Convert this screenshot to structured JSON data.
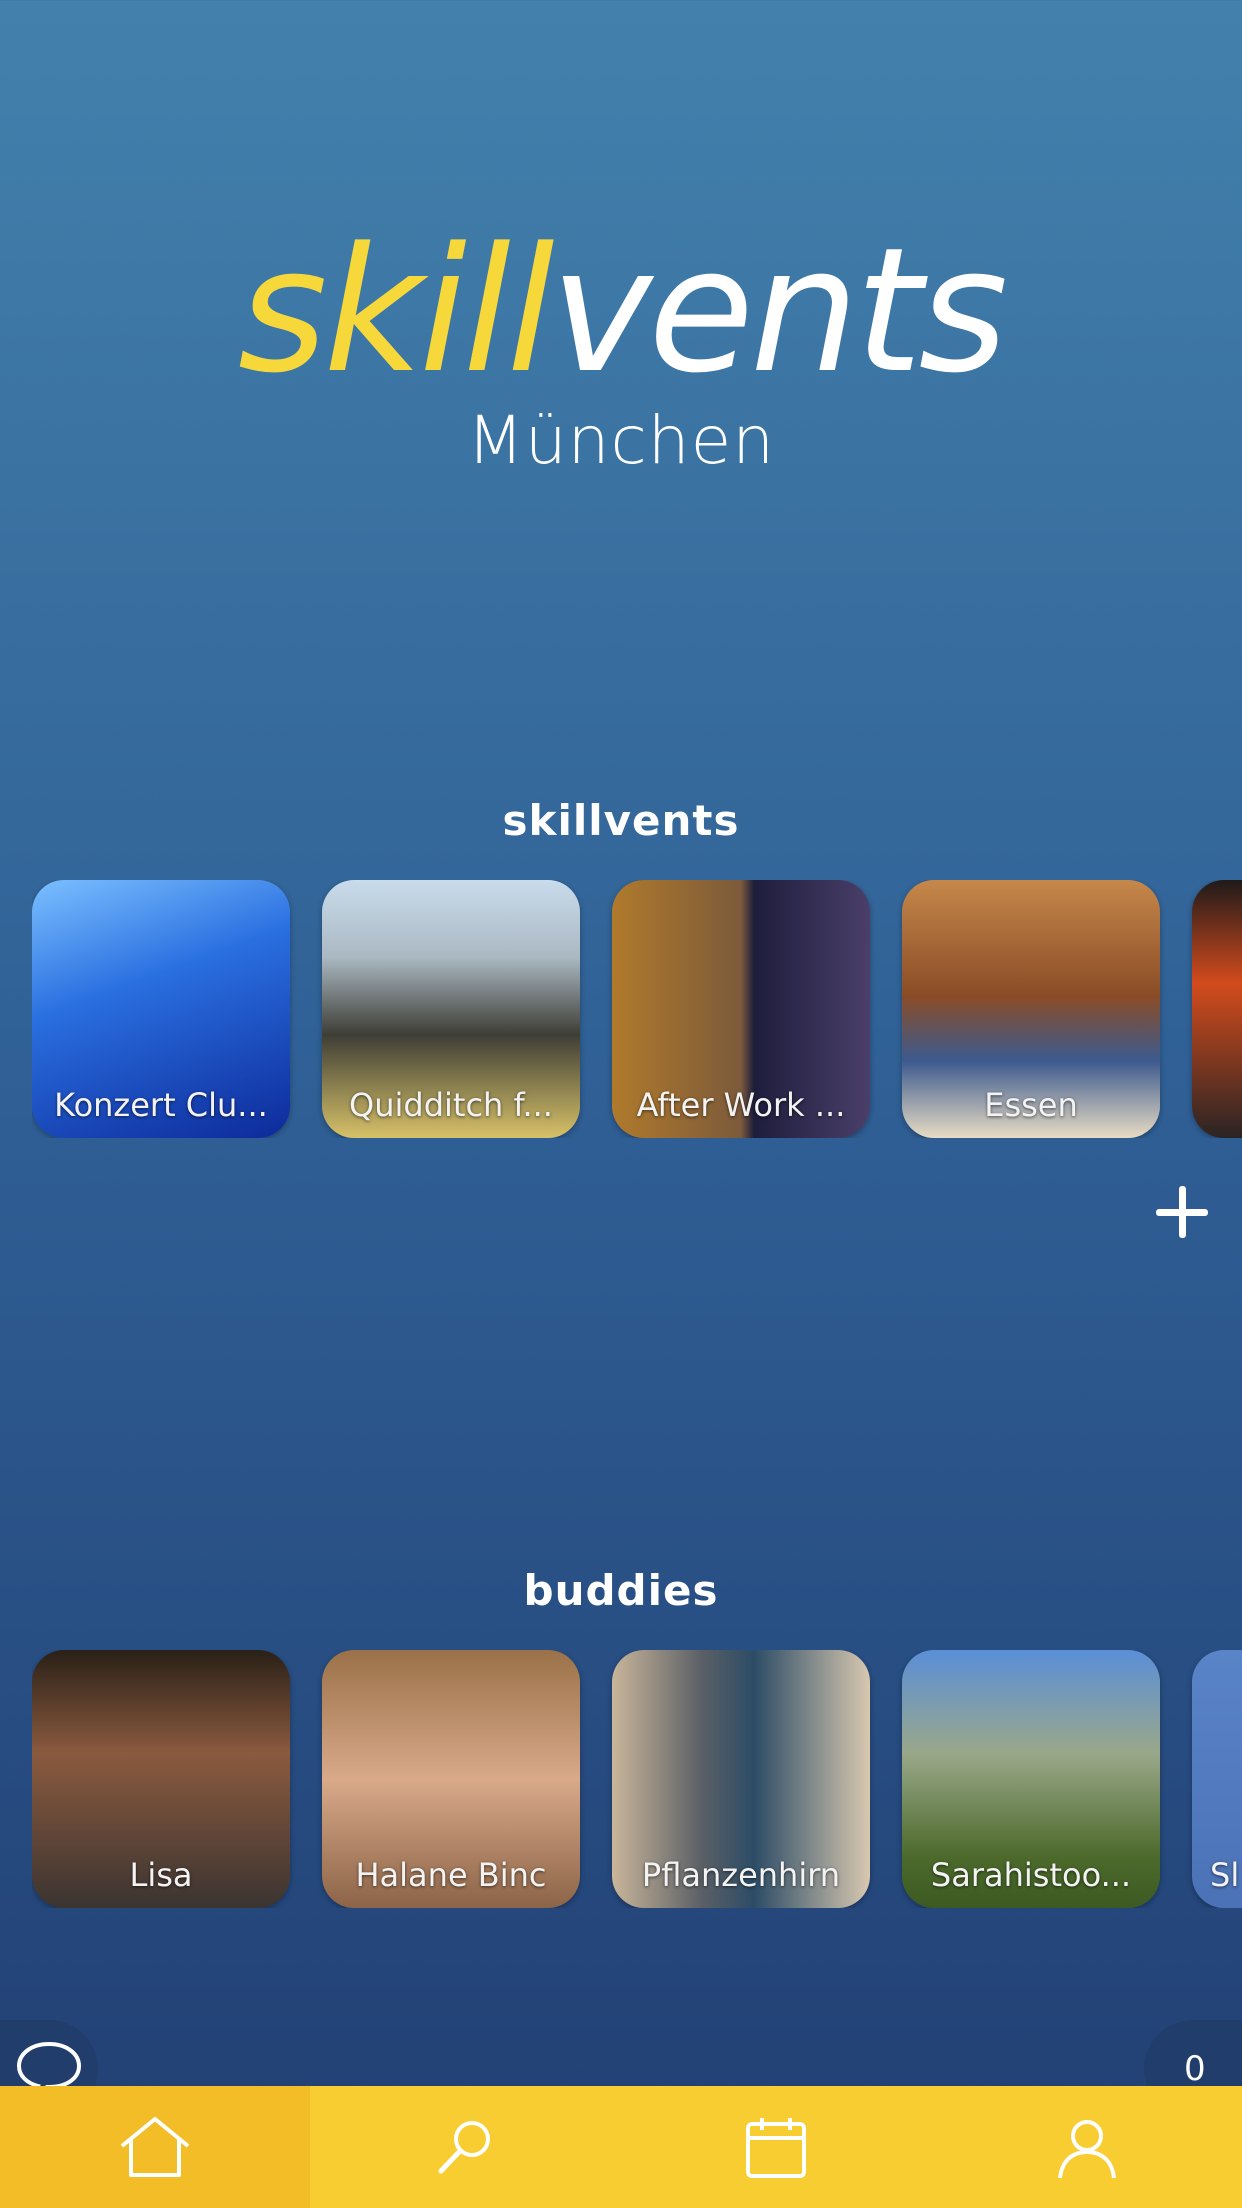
{
  "header": {
    "logo_skill": "skill",
    "logo_vents": "vents",
    "city": "München"
  },
  "skillvents": {
    "title": "skillvents",
    "items": [
      {
        "label": "Konzert Clu..."
      },
      {
        "label": "Quidditch f..."
      },
      {
        "label": "After Work ..."
      },
      {
        "label": "Essen"
      },
      {
        "label": ""
      }
    ]
  },
  "buddies": {
    "title": "buddies",
    "items": [
      {
        "label": "Lisa"
      },
      {
        "label": "Halane Binc"
      },
      {
        "label": "Pflanzenhirn"
      },
      {
        "label": "Sarahistoo..."
      },
      {
        "label": "Sl"
      }
    ]
  },
  "counter": "0",
  "nav": [
    "home-icon",
    "search-icon",
    "calendar-icon",
    "profile-icon"
  ],
  "colors": {
    "accent_yellow": "#f8cd31",
    "bg_top": "#4381ac",
    "bg_bottom": "#213e72"
  }
}
